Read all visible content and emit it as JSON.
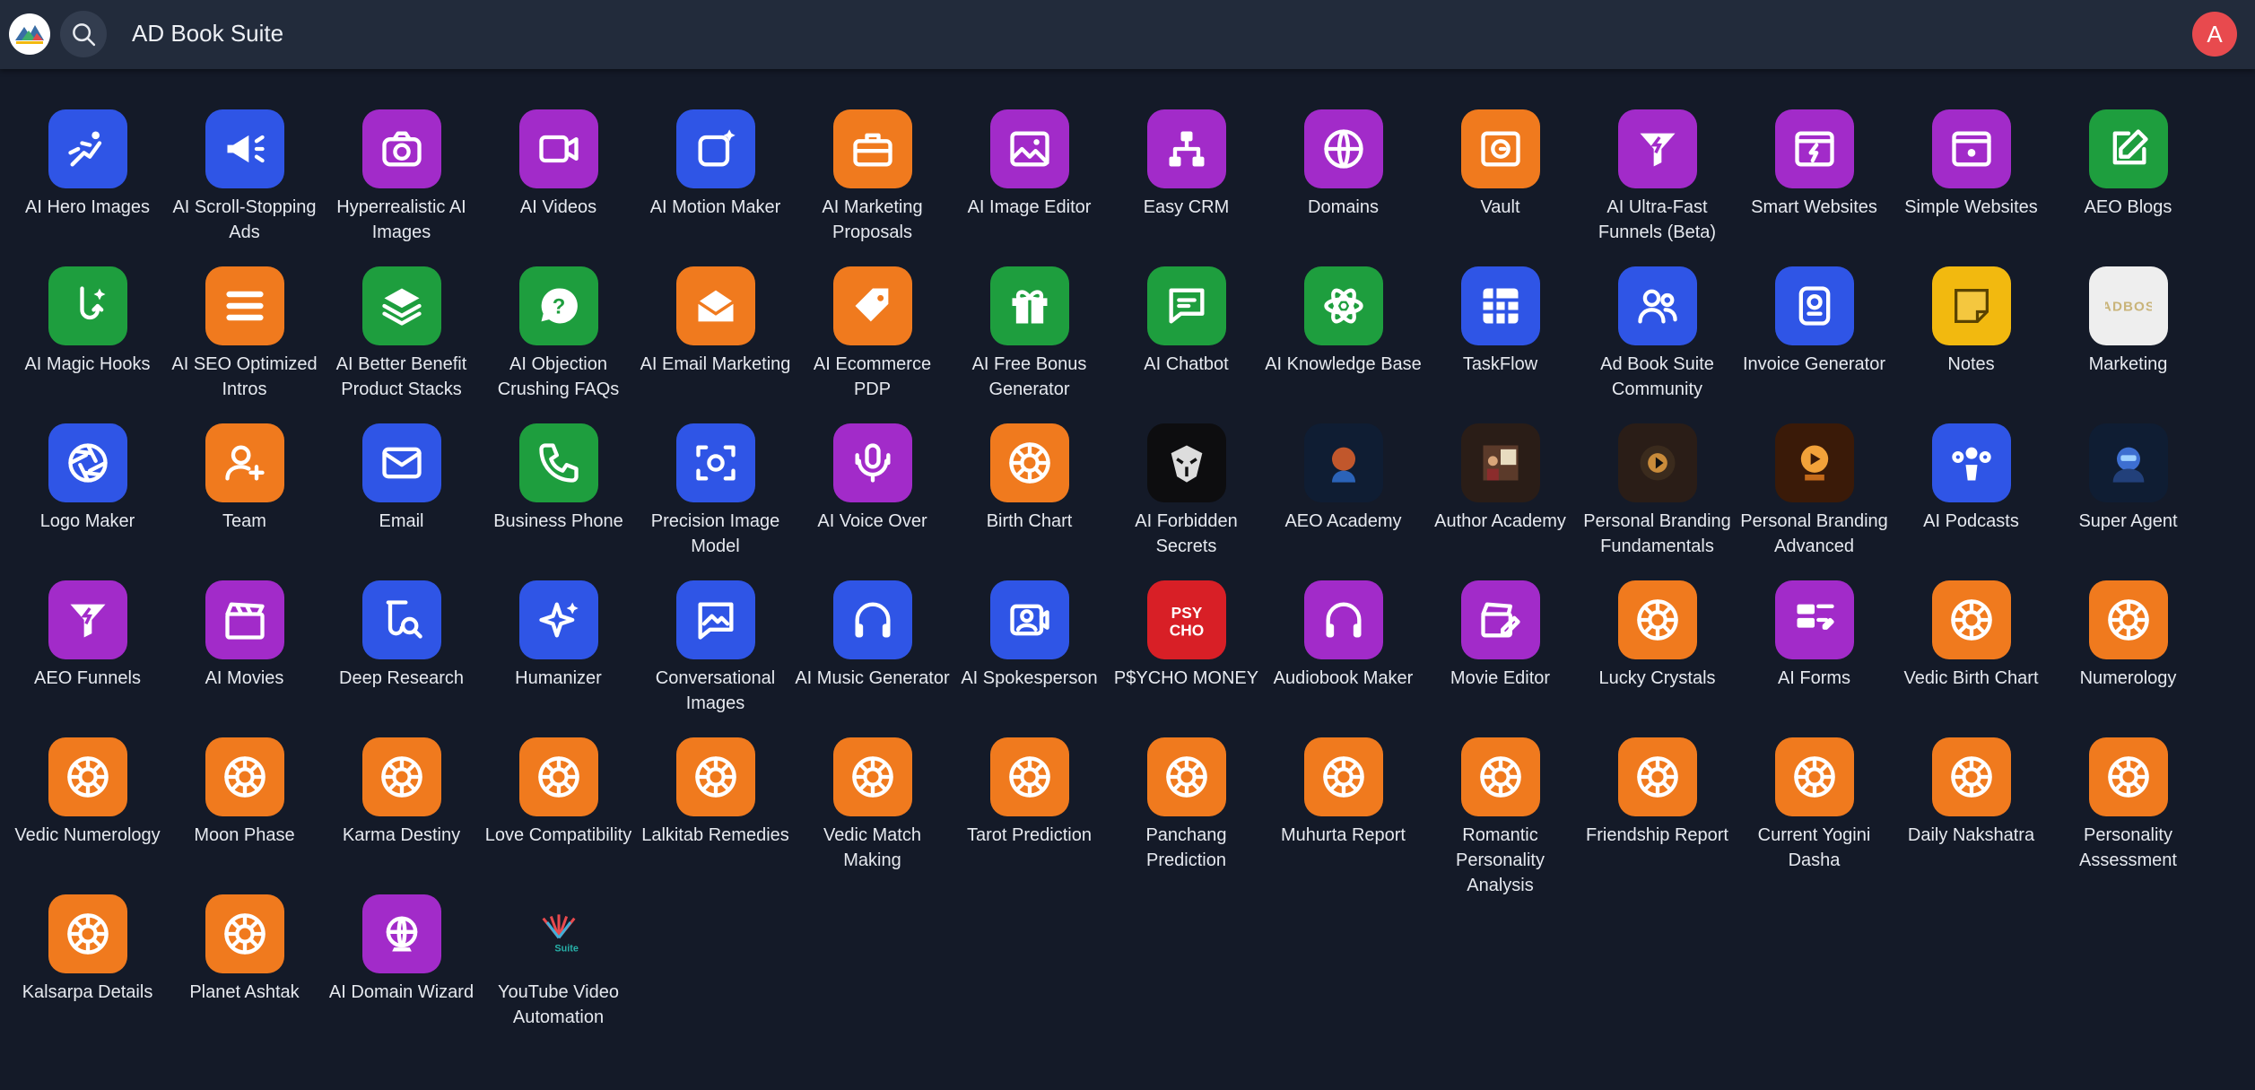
{
  "header": {
    "title": "AD Book Suite",
    "avatar_letter": "A"
  },
  "apps": [
    {
      "label": "AI Hero Images",
      "icon": "flying-person-icon",
      "color": "blue"
    },
    {
      "label": "AI Scroll-Stopping Ads",
      "icon": "megaphone-icon",
      "color": "blue"
    },
    {
      "label": "Hyperrealistic AI Images",
      "icon": "camera-icon",
      "color": "purple"
    },
    {
      "label": "AI Videos",
      "icon": "video-camera-icon",
      "color": "purple"
    },
    {
      "label": "AI Motion Maker",
      "icon": "motion-sparkle-icon",
      "color": "blue"
    },
    {
      "label": "AI Marketing Proposals",
      "icon": "briefcase-icon",
      "color": "orange"
    },
    {
      "label": "AI Image Editor",
      "icon": "image-icon",
      "color": "purple"
    },
    {
      "label": "Easy CRM",
      "icon": "hierarchy-icon",
      "color": "purple"
    },
    {
      "label": "Domains",
      "icon": "globe-icon",
      "color": "purple"
    },
    {
      "label": "Vault",
      "icon": "vault-icon",
      "color": "orange"
    },
    {
      "label": "AI Ultra-Fast Funnels (Beta)",
      "icon": "funnel-bolt-icon",
      "color": "purple"
    },
    {
      "label": "Smart Websites",
      "icon": "browser-bolt-icon",
      "color": "purple"
    },
    {
      "label": "Simple Websites",
      "icon": "browser-light-icon",
      "color": "purple"
    },
    {
      "label": "AEO Blogs",
      "icon": "edit-icon",
      "color": "green"
    },
    {
      "label": "AI Magic Hooks",
      "icon": "hook-icon",
      "color": "green"
    },
    {
      "label": "AI SEO Optimized Intros",
      "icon": "lines-icon",
      "color": "orange"
    },
    {
      "label": "AI Better Benefit Product Stacks",
      "icon": "layers-icon",
      "color": "green"
    },
    {
      "label": "AI Objection Crushing FAQs",
      "icon": "question-icon",
      "color": "green"
    },
    {
      "label": "AI Email Marketing",
      "icon": "envelope-open-icon",
      "color": "orange"
    },
    {
      "label": "AI Ecommerce PDP",
      "icon": "tag-icon",
      "color": "orange"
    },
    {
      "label": "AI Free Bonus Generator",
      "icon": "gift-icon",
      "color": "green"
    },
    {
      "label": "AI Chatbot",
      "icon": "chat-icon",
      "color": "green"
    },
    {
      "label": "AI Knowledge Base",
      "icon": "atom-icon",
      "color": "green"
    },
    {
      "label": "TaskFlow",
      "icon": "board-icon",
      "color": "blue"
    },
    {
      "label": "Ad Book Suite Community",
      "icon": "users-icon",
      "color": "blue"
    },
    {
      "label": "Invoice Generator",
      "icon": "invoice-icon",
      "color": "blue"
    },
    {
      "label": "Notes",
      "icon": "note-icon",
      "color": "yellow"
    },
    {
      "label": "Marketing",
      "icon": "marketing-logo-icon",
      "color": "light"
    },
    {
      "label": "Logo Maker",
      "icon": "aperture-icon",
      "color": "blue"
    },
    {
      "label": "Team",
      "icon": "add-user-icon",
      "color": "orange"
    },
    {
      "label": "Email",
      "icon": "mail-icon",
      "color": "blue"
    },
    {
      "label": "Business Phone",
      "icon": "phone-icon",
      "color": "green"
    },
    {
      "label": "Precision Image Model",
      "icon": "focus-icon",
      "color": "blue"
    },
    {
      "label": "AI Voice Over",
      "icon": "microphone-icon",
      "color": "purple"
    },
    {
      "label": "Birth Chart",
      "icon": "zodiac-wheel-icon",
      "color": "orange"
    },
    {
      "label": "AI Forbidden Secrets",
      "icon": "mask-photo-icon",
      "color": "black"
    },
    {
      "label": "AEO Academy",
      "icon": "ai-head-photo-icon",
      "color": "dark-blue"
    },
    {
      "label": "Author Academy",
      "icon": "author-photo-icon",
      "color": "dark-brown"
    },
    {
      "label": "Personal Branding Fundamentals",
      "icon": "branding-photo-icon",
      "color": "dark-brown"
    },
    {
      "label": "Personal Branding Advanced",
      "icon": "branding-advanced-photo-icon",
      "color": "dark-orange"
    },
    {
      "label": "AI Podcasts",
      "icon": "podcast-icon",
      "color": "blue"
    },
    {
      "label": "Super Agent",
      "icon": "robot-photo-icon",
      "color": "dark-blue"
    },
    {
      "label": "AEO Funnels",
      "icon": "funnel-bolt-icon",
      "color": "purple"
    },
    {
      "label": "AI Movies",
      "icon": "clapperboard-icon",
      "color": "purple"
    },
    {
      "label": "Deep Research",
      "icon": "research-icon",
      "color": "blue"
    },
    {
      "label": "Humanizer",
      "icon": "sparkles-icon",
      "color": "blue"
    },
    {
      "label": "Conversational Images",
      "icon": "image-chat-icon",
      "color": "blue"
    },
    {
      "label": "AI Music Generator",
      "icon": "headphones-icon",
      "color": "blue"
    },
    {
      "label": "AI Spokesperson",
      "icon": "spokesperson-icon",
      "color": "blue"
    },
    {
      "label": "P$YCHO MONEY",
      "icon": "psycho-logo-icon",
      "color": "red",
      "logo_text": "PSY CHO"
    },
    {
      "label": "Audiobook Maker",
      "icon": "headphones-icon",
      "color": "purple"
    },
    {
      "label": "Movie Editor",
      "icon": "clapper-edit-icon",
      "color": "purple"
    },
    {
      "label": "Lucky Crystals",
      "icon": "zodiac-wheel-icon",
      "color": "orange"
    },
    {
      "label": "AI Forms",
      "icon": "forms-icon",
      "color": "purple"
    },
    {
      "label": "Vedic Birth Chart",
      "icon": "zodiac-wheel-icon",
      "color": "orange"
    },
    {
      "label": "Numerology",
      "icon": "zodiac-wheel-icon",
      "color": "orange"
    },
    {
      "label": "Vedic Numerology",
      "icon": "zodiac-wheel-icon",
      "color": "orange"
    },
    {
      "label": "Moon Phase",
      "icon": "zodiac-wheel-icon",
      "color": "orange"
    },
    {
      "label": "Karma Destiny",
      "icon": "zodiac-wheel-icon",
      "color": "orange"
    },
    {
      "label": "Love Compatibility",
      "icon": "zodiac-wheel-icon",
      "color": "orange"
    },
    {
      "label": "Lalkitab Remedies",
      "icon": "zodiac-wheel-icon",
      "color": "orange"
    },
    {
      "label": "Vedic Match Making",
      "icon": "zodiac-wheel-icon",
      "color": "orange"
    },
    {
      "label": "Tarot Prediction",
      "icon": "zodiac-wheel-icon",
      "color": "orange"
    },
    {
      "label": "Panchang Prediction",
      "icon": "zodiac-wheel-icon",
      "color": "orange"
    },
    {
      "label": "Muhurta Report",
      "icon": "zodiac-wheel-icon",
      "color": "orange"
    },
    {
      "label": "Romantic Personality Analysis",
      "icon": "zodiac-wheel-icon",
      "color": "orange"
    },
    {
      "label": "Friendship Report",
      "icon": "zodiac-wheel-icon",
      "color": "orange"
    },
    {
      "label": "Current Yogini Dasha",
      "icon": "zodiac-wheel-icon",
      "color": "orange"
    },
    {
      "label": "Daily Nakshatra",
      "icon": "zodiac-wheel-icon",
      "color": "orange"
    },
    {
      "label": "Personality Assessment",
      "icon": "zodiac-wheel-icon",
      "color": "orange"
    },
    {
      "label": "Kalsarpa Details",
      "icon": "zodiac-wheel-icon",
      "color": "orange"
    },
    {
      "label": "Planet Ashtak",
      "icon": "zodiac-wheel-icon",
      "color": "orange"
    },
    {
      "label": "AI Domain Wizard",
      "icon": "crystal-globe-icon",
      "color": "purple"
    },
    {
      "label": "YouTube Video Automation",
      "icon": "suite-logo-icon",
      "color": "none",
      "logo_text": "Suite"
    }
  ],
  "colors": {
    "blue": "#2f55e6",
    "purple": "#a22bc9",
    "orange": "#f07a1e",
    "green": "#1e9e3e",
    "yellow": "#f2b90f",
    "red": "#d81f26",
    "light": "#eeeeee",
    "black": "#0d0d0f",
    "dark-blue": "#0f1d33",
    "dark-brown": "#2a1d17",
    "dark-orange": "#3a1a08",
    "none": "transparent"
  }
}
